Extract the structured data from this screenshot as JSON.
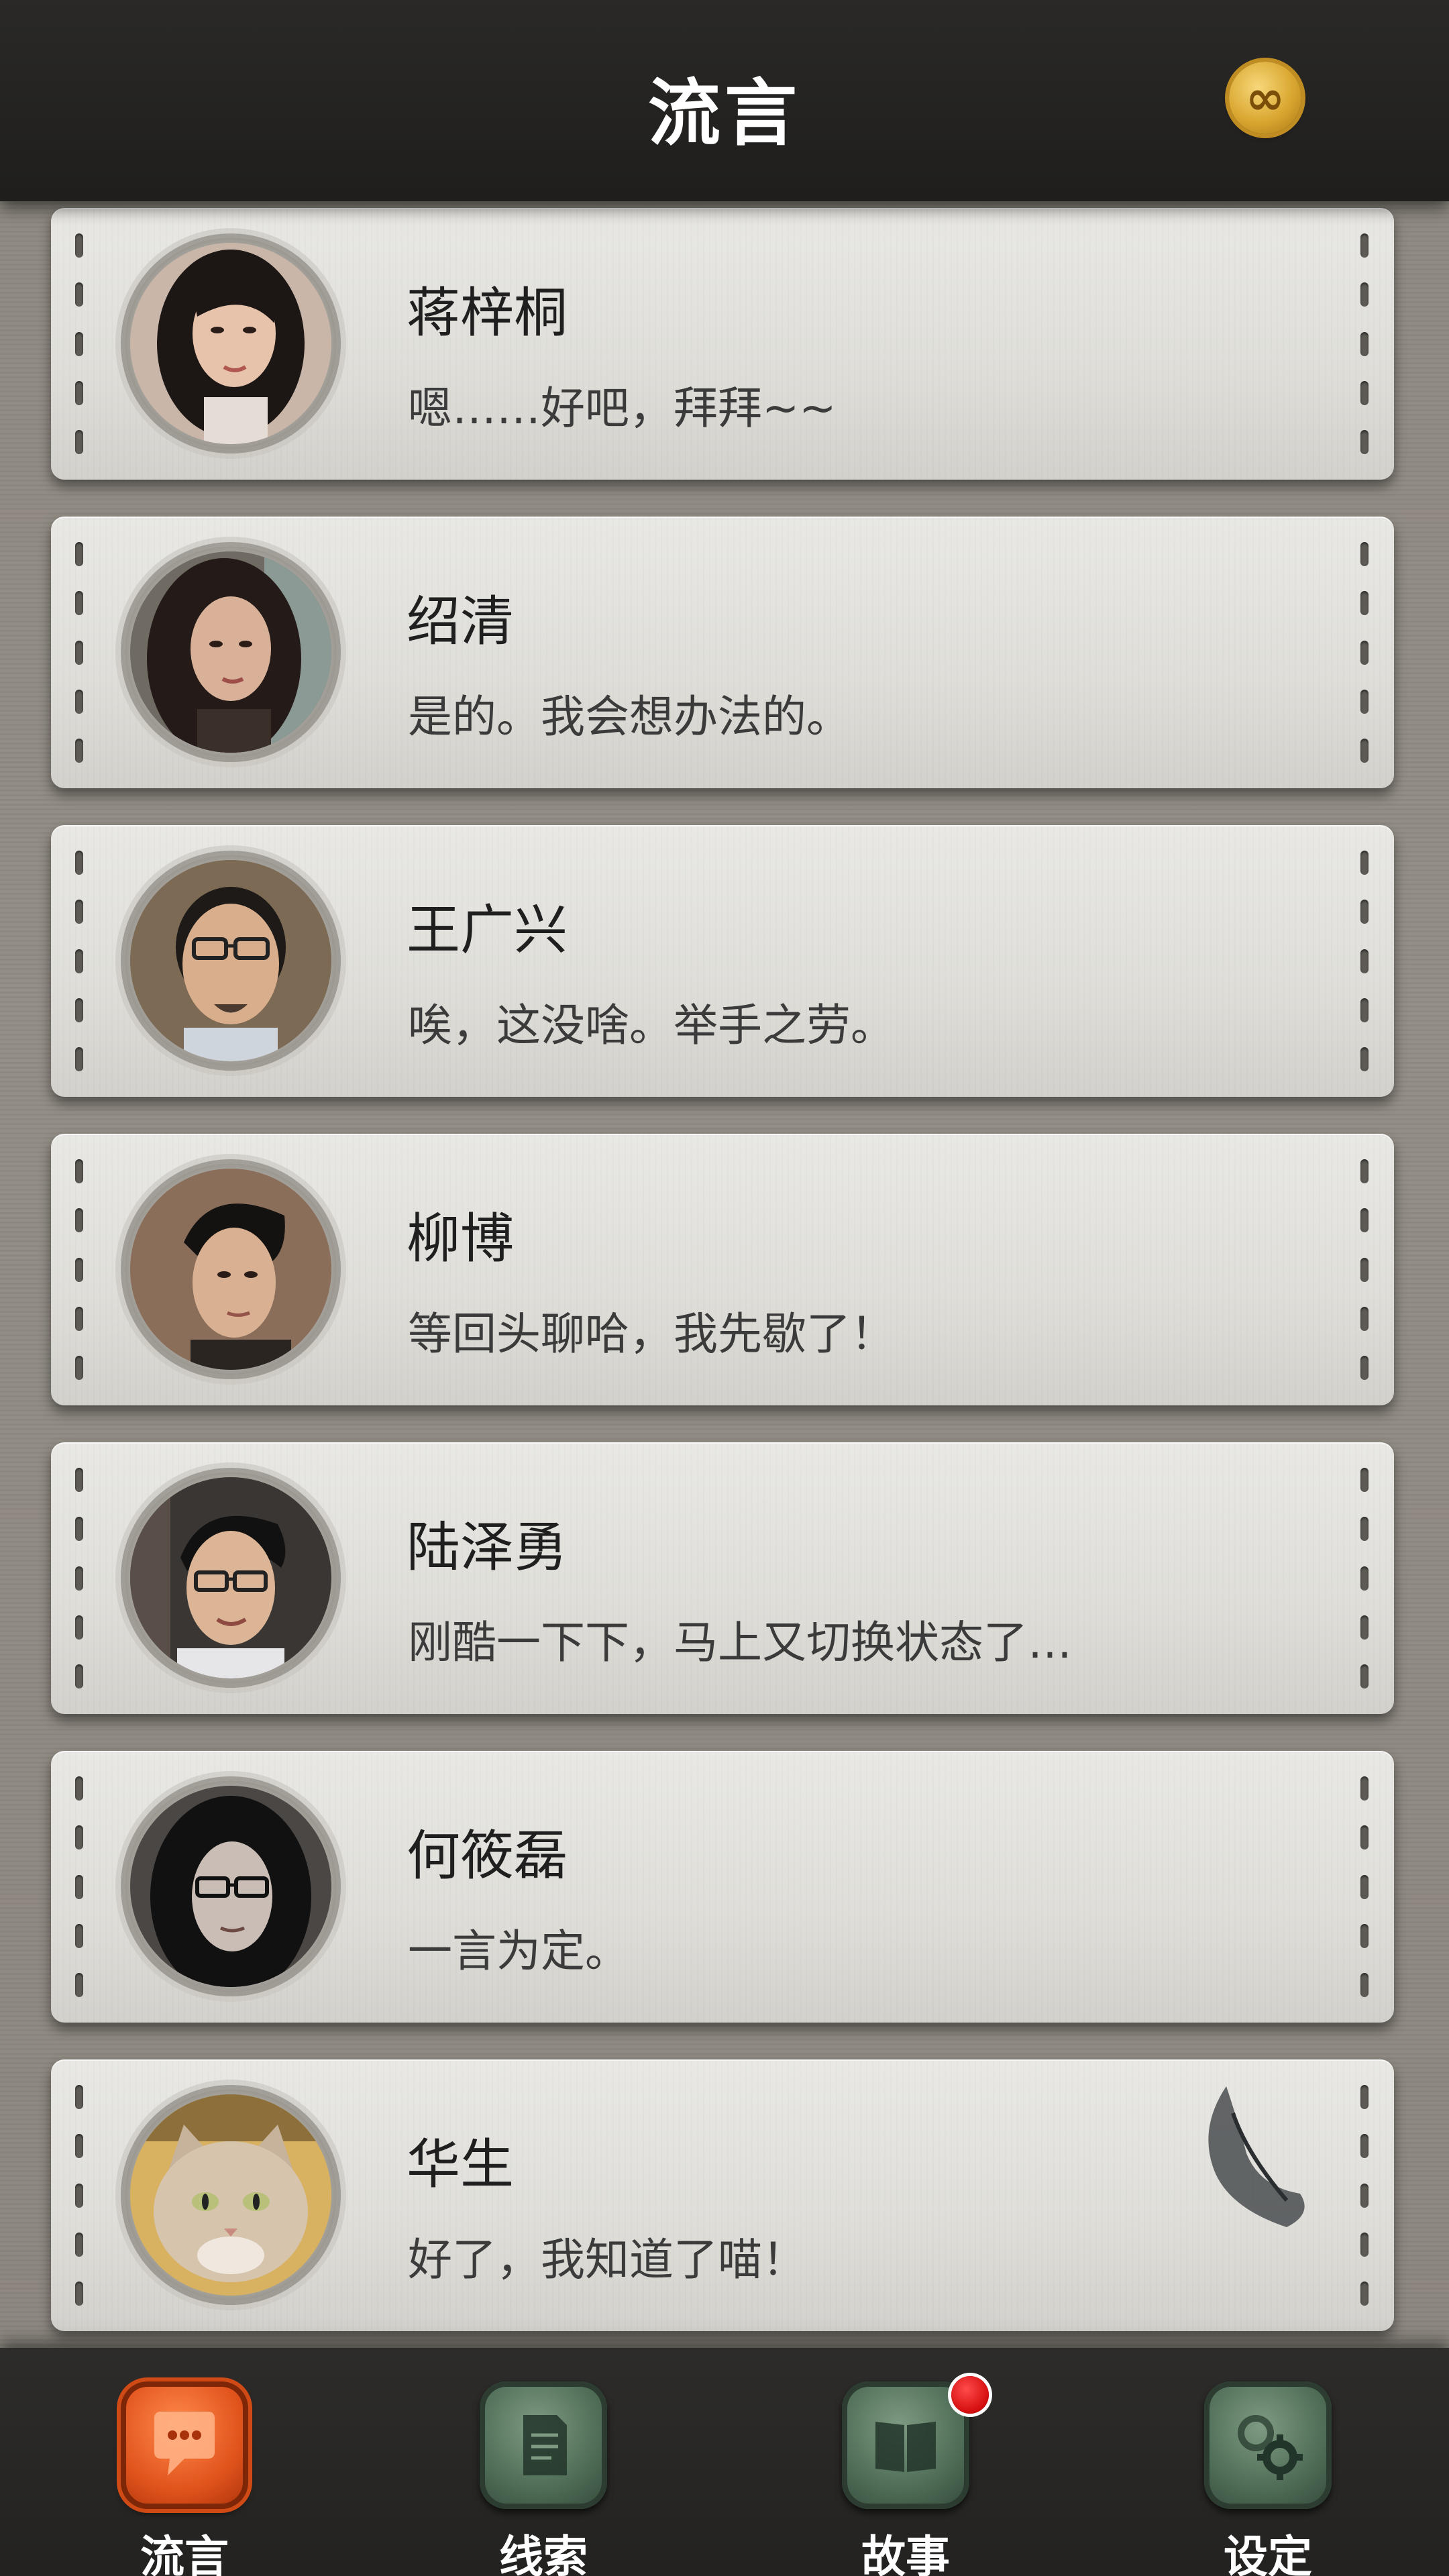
{
  "header": {
    "title": "流言",
    "coin_icon": "infinity-coin-icon",
    "coin_symbol": "∞"
  },
  "conversations": [
    {
      "name": "蒋梓桐",
      "message": "嗯……好吧，拜拜~~"
    },
    {
      "name": "绍清",
      "message": "是的。我会想办法的。"
    },
    {
      "name": "王广兴",
      "message": "唉，这没啥。举手之劳。"
    },
    {
      "name": "柳博",
      "message": "等回头聊哈，我先歇了！"
    },
    {
      "name": "陆泽勇",
      "message": "刚酷一下下，马上又切换状态了…"
    },
    {
      "name": "何筱磊",
      "message": "一言为定。"
    },
    {
      "name": "华生",
      "message": "好了，我知道了喵！"
    }
  ],
  "tabs": [
    {
      "label": "流言",
      "icon": "chat-bubble-icon",
      "active": true
    },
    {
      "label": "线索",
      "icon": "document-icon",
      "active": false
    },
    {
      "label": "故事",
      "icon": "book-icon",
      "active": false,
      "badge": true
    },
    {
      "label": "设定",
      "icon": "gear-icon",
      "active": false
    }
  ],
  "colors": {
    "active_tab": "#e0521b",
    "inactive_tab": "#4d6b55",
    "badge": "#d40d0d"
  }
}
